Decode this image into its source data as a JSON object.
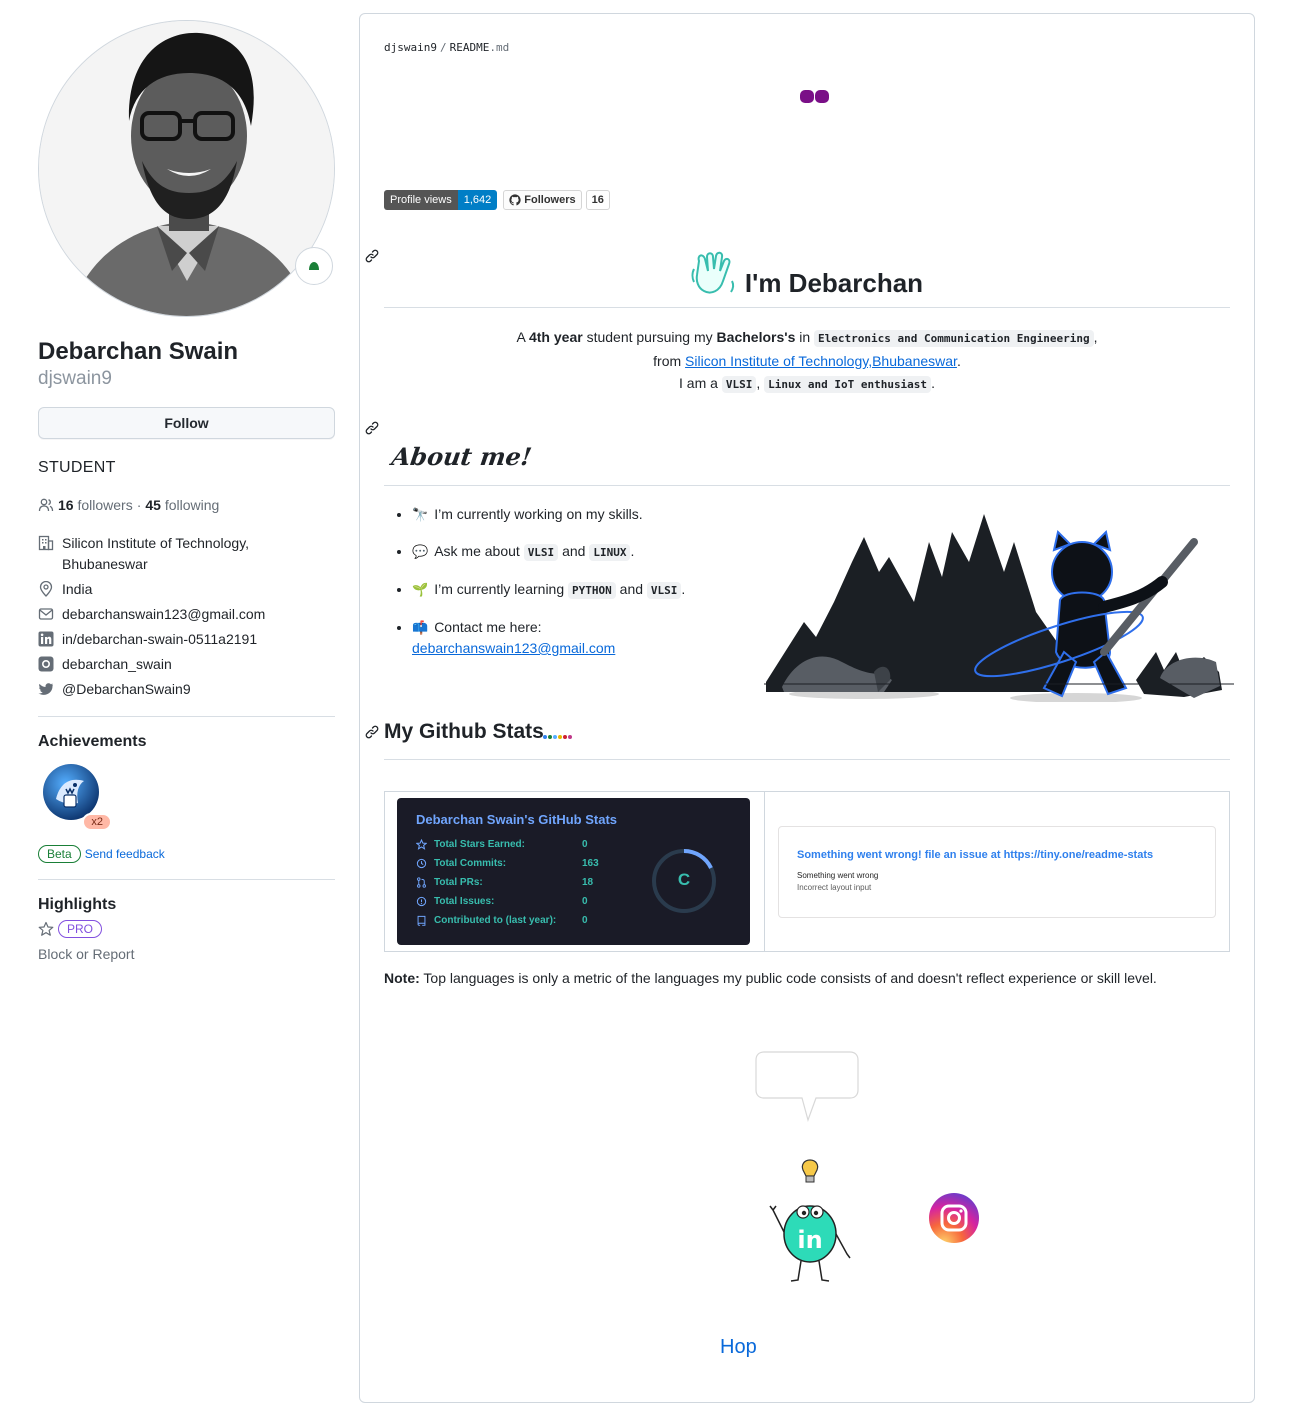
{
  "profile": {
    "full_name": "Debarchan Swain",
    "username": "djswain9",
    "follow_label": "Follow",
    "bio": "STUDENT",
    "followers_count": "16",
    "followers_label": "followers",
    "separator": "·",
    "following_count": "45",
    "following_label": "following",
    "organization": "Silicon Institute of Technology, Bhubaneswar",
    "location": "India",
    "email": "debarchanswain123@gmail.com",
    "linkedin": "in/debarchan-swain-0511a2191",
    "instagram": "debarchan_swain",
    "twitter": "@DebarchanSwain9"
  },
  "achievements": {
    "title": "Achievements",
    "badge_count": "x2",
    "beta_label": "Beta",
    "feedback_label": "Send feedback"
  },
  "highlights": {
    "title": "Highlights",
    "pro_label": "PRO",
    "block_label": "Block or Report"
  },
  "readme": {
    "breadcrumb_user": "djswain9",
    "breadcrumb_sep": "/",
    "breadcrumb_file": "README",
    "breadcrumb_ext": ".md",
    "badge_views_label": "Profile views",
    "badge_views_value": "1,642",
    "badge_followers_label": "Followers",
    "badge_followers_value": "16",
    "heading": "I'm Debarchan",
    "intro": {
      "p1_a": "A ",
      "p1_b": "4th year",
      "p1_c": " student pursuing my ",
      "p1_d": "Bachelors's",
      "p1_e": " in ",
      "p1_code": "Electronics and Communication Engineering",
      "p1_f": ",",
      "p2_a": "from ",
      "p2_link": "Silicon Institute of Technology,Bhubaneswar",
      "p2_b": ".",
      "p3_a": "I am a ",
      "p3_code1": "VLSI",
      "p3_b": ", ",
      "p3_code2": "Linux and IoT enthusiast",
      "p3_c": "."
    },
    "about_heading": "About me!",
    "about": {
      "i1_emoji": "🔭",
      "i1_text": "I’m currently working on my skills.",
      "i2_emoji": "💬",
      "i2_a": "Ask me about ",
      "i2_code1": "VLSI",
      "i2_b": " and ",
      "i2_code2": "LINUX",
      "i2_c": ".",
      "i3_emoji": "🌱",
      "i3_a": "I’m currently learning ",
      "i3_code1": "PYTHON",
      "i3_b": " and ",
      "i3_code2": "VLSI",
      "i3_c": ".",
      "i4_emoji": "📫",
      "i4_text": "Contact me here:",
      "i4_link": "debarchanswain123@gmail.com"
    },
    "stats_heading": "My Github Stats",
    "stats_card": {
      "title": "Debarchan Swain's GitHub Stats",
      "rows": [
        {
          "label": "Total Stars Earned:",
          "value": "0"
        },
        {
          "label": "Total Commits:",
          "value": "163"
        },
        {
          "label": "Total PRs:",
          "value": "18"
        },
        {
          "label": "Total Issues:",
          "value": "0"
        },
        {
          "label": "Contributed to (last year):",
          "value": "0"
        }
      ],
      "rank": "C"
    },
    "error_card": {
      "line1": "Something went wrong! file an issue at https://tiny.one/readme-stats",
      "line2": "Something went wrong",
      "line3": "Incorrect layout input"
    },
    "note_bold": "Note:",
    "note_text": " Top languages is only a metric of the languages my public code consists of and doesn't reflect experience or skill level.",
    "linkedin_badge_text": "in",
    "hop": "Hop"
  },
  "colors": {
    "link": "#0969da",
    "card_bg": "#1a1b27",
    "card_title": "#70a5fd",
    "card_text": "#38bdae",
    "dots": "#7a0f87"
  }
}
